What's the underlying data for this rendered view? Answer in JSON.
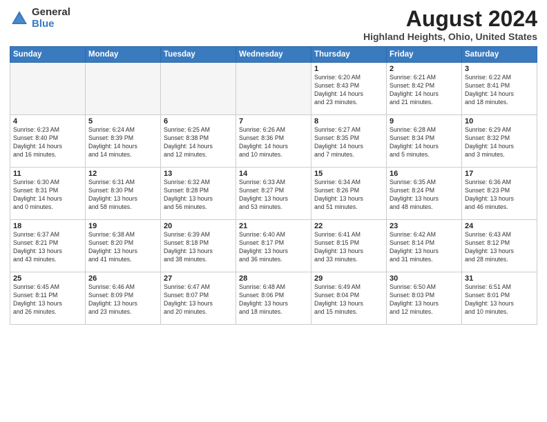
{
  "logo": {
    "general": "General",
    "blue": "Blue"
  },
  "title": "August 2024",
  "location": "Highland Heights, Ohio, United States",
  "headers": [
    "Sunday",
    "Monday",
    "Tuesday",
    "Wednesday",
    "Thursday",
    "Friday",
    "Saturday"
  ],
  "weeks": [
    [
      {
        "day": "",
        "text": ""
      },
      {
        "day": "",
        "text": ""
      },
      {
        "day": "",
        "text": ""
      },
      {
        "day": "",
        "text": ""
      },
      {
        "day": "1",
        "text": "Sunrise: 6:20 AM\nSunset: 8:43 PM\nDaylight: 14 hours\nand 23 minutes."
      },
      {
        "day": "2",
        "text": "Sunrise: 6:21 AM\nSunset: 8:42 PM\nDaylight: 14 hours\nand 21 minutes."
      },
      {
        "day": "3",
        "text": "Sunrise: 6:22 AM\nSunset: 8:41 PM\nDaylight: 14 hours\nand 18 minutes."
      }
    ],
    [
      {
        "day": "4",
        "text": "Sunrise: 6:23 AM\nSunset: 8:40 PM\nDaylight: 14 hours\nand 16 minutes."
      },
      {
        "day": "5",
        "text": "Sunrise: 6:24 AM\nSunset: 8:39 PM\nDaylight: 14 hours\nand 14 minutes."
      },
      {
        "day": "6",
        "text": "Sunrise: 6:25 AM\nSunset: 8:38 PM\nDaylight: 14 hours\nand 12 minutes."
      },
      {
        "day": "7",
        "text": "Sunrise: 6:26 AM\nSunset: 8:36 PM\nDaylight: 14 hours\nand 10 minutes."
      },
      {
        "day": "8",
        "text": "Sunrise: 6:27 AM\nSunset: 8:35 PM\nDaylight: 14 hours\nand 7 minutes."
      },
      {
        "day": "9",
        "text": "Sunrise: 6:28 AM\nSunset: 8:34 PM\nDaylight: 14 hours\nand 5 minutes."
      },
      {
        "day": "10",
        "text": "Sunrise: 6:29 AM\nSunset: 8:32 PM\nDaylight: 14 hours\nand 3 minutes."
      }
    ],
    [
      {
        "day": "11",
        "text": "Sunrise: 6:30 AM\nSunset: 8:31 PM\nDaylight: 14 hours\nand 0 minutes."
      },
      {
        "day": "12",
        "text": "Sunrise: 6:31 AM\nSunset: 8:30 PM\nDaylight: 13 hours\nand 58 minutes."
      },
      {
        "day": "13",
        "text": "Sunrise: 6:32 AM\nSunset: 8:28 PM\nDaylight: 13 hours\nand 56 minutes."
      },
      {
        "day": "14",
        "text": "Sunrise: 6:33 AM\nSunset: 8:27 PM\nDaylight: 13 hours\nand 53 minutes."
      },
      {
        "day": "15",
        "text": "Sunrise: 6:34 AM\nSunset: 8:26 PM\nDaylight: 13 hours\nand 51 minutes."
      },
      {
        "day": "16",
        "text": "Sunrise: 6:35 AM\nSunset: 8:24 PM\nDaylight: 13 hours\nand 48 minutes."
      },
      {
        "day": "17",
        "text": "Sunrise: 6:36 AM\nSunset: 8:23 PM\nDaylight: 13 hours\nand 46 minutes."
      }
    ],
    [
      {
        "day": "18",
        "text": "Sunrise: 6:37 AM\nSunset: 8:21 PM\nDaylight: 13 hours\nand 43 minutes."
      },
      {
        "day": "19",
        "text": "Sunrise: 6:38 AM\nSunset: 8:20 PM\nDaylight: 13 hours\nand 41 minutes."
      },
      {
        "day": "20",
        "text": "Sunrise: 6:39 AM\nSunset: 8:18 PM\nDaylight: 13 hours\nand 38 minutes."
      },
      {
        "day": "21",
        "text": "Sunrise: 6:40 AM\nSunset: 8:17 PM\nDaylight: 13 hours\nand 36 minutes."
      },
      {
        "day": "22",
        "text": "Sunrise: 6:41 AM\nSunset: 8:15 PM\nDaylight: 13 hours\nand 33 minutes."
      },
      {
        "day": "23",
        "text": "Sunrise: 6:42 AM\nSunset: 8:14 PM\nDaylight: 13 hours\nand 31 minutes."
      },
      {
        "day": "24",
        "text": "Sunrise: 6:43 AM\nSunset: 8:12 PM\nDaylight: 13 hours\nand 28 minutes."
      }
    ],
    [
      {
        "day": "25",
        "text": "Sunrise: 6:45 AM\nSunset: 8:11 PM\nDaylight: 13 hours\nand 26 minutes."
      },
      {
        "day": "26",
        "text": "Sunrise: 6:46 AM\nSunset: 8:09 PM\nDaylight: 13 hours\nand 23 minutes."
      },
      {
        "day": "27",
        "text": "Sunrise: 6:47 AM\nSunset: 8:07 PM\nDaylight: 13 hours\nand 20 minutes."
      },
      {
        "day": "28",
        "text": "Sunrise: 6:48 AM\nSunset: 8:06 PM\nDaylight: 13 hours\nand 18 minutes."
      },
      {
        "day": "29",
        "text": "Sunrise: 6:49 AM\nSunset: 8:04 PM\nDaylight: 13 hours\nand 15 minutes."
      },
      {
        "day": "30",
        "text": "Sunrise: 6:50 AM\nSunset: 8:03 PM\nDaylight: 13 hours\nand 12 minutes."
      },
      {
        "day": "31",
        "text": "Sunrise: 6:51 AM\nSunset: 8:01 PM\nDaylight: 13 hours\nand 10 minutes."
      }
    ]
  ]
}
